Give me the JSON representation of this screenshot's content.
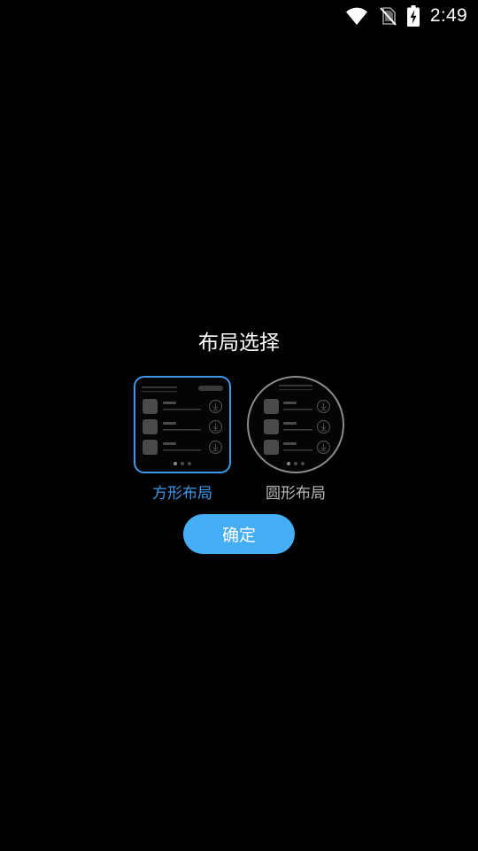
{
  "status_bar": {
    "time": "2:49",
    "icons": [
      "wifi-icon",
      "no-sim-icon",
      "battery-charging-icon"
    ]
  },
  "dialog": {
    "title": "布局选择",
    "options": [
      {
        "label": "方形布局",
        "shape": "square",
        "selected": true
      },
      {
        "label": "圆形布局",
        "shape": "round",
        "selected": false
      }
    ],
    "confirm_label": "确定"
  },
  "colors": {
    "background": "#000000",
    "accent": "#3d97e8",
    "button": "#45aef5",
    "inactive_border": "#8c8c8c",
    "inactive_text": "#b8b8b8"
  }
}
